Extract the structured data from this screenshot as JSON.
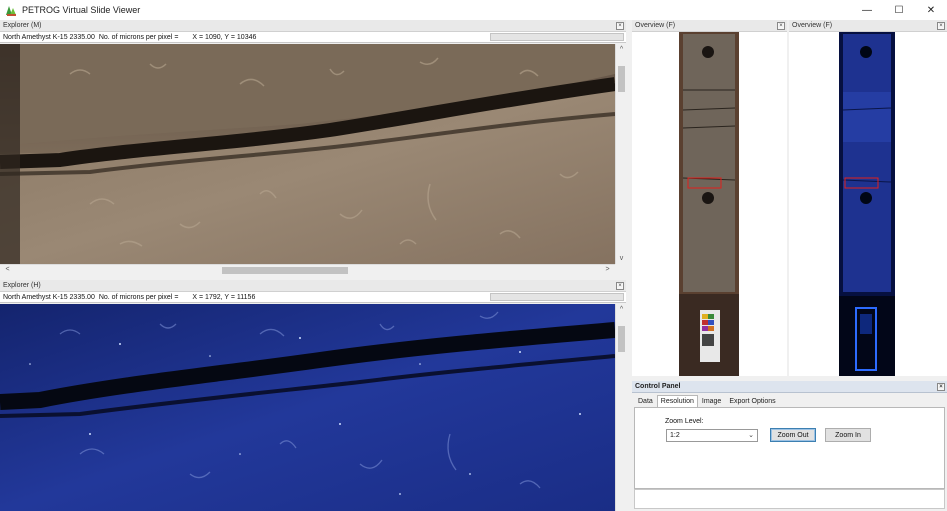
{
  "window": {
    "title": "PETROG Virtual Slide Viewer",
    "controls": {
      "minimize": "—",
      "maximize": "☐",
      "close": "✕"
    }
  },
  "explorer_top": {
    "header": "Explorer (M)",
    "slide": "North Amethyst K-15 2335.00",
    "microns_label": "No. of microns per pixel =",
    "coords": "X = 1090, Y = 10346"
  },
  "explorer_bottom": {
    "header": "Explorer (H)",
    "slide": "North Amethyst K-15 2335.00",
    "microns_label": "No. of microns per pixel =",
    "coords": "X = 1792, Y = 11156"
  },
  "overview_left": {
    "header": "Overview (F)"
  },
  "overview_right": {
    "header": "Overview (F)"
  },
  "control_panel": {
    "header": "Control Panel",
    "tabs": [
      "Data",
      "Resolution",
      "Image",
      "Export Options"
    ],
    "active_tab": "Resolution",
    "zoom_label": "Zoom Level:",
    "zoom_value": "1:2",
    "zoom_out": "Zoom Out",
    "zoom_in": "Zoom In"
  },
  "colors": {
    "rock_brown": "#7a6a58",
    "uv_blue": "#1a2f8a",
    "selection_red": "#e0201c"
  }
}
